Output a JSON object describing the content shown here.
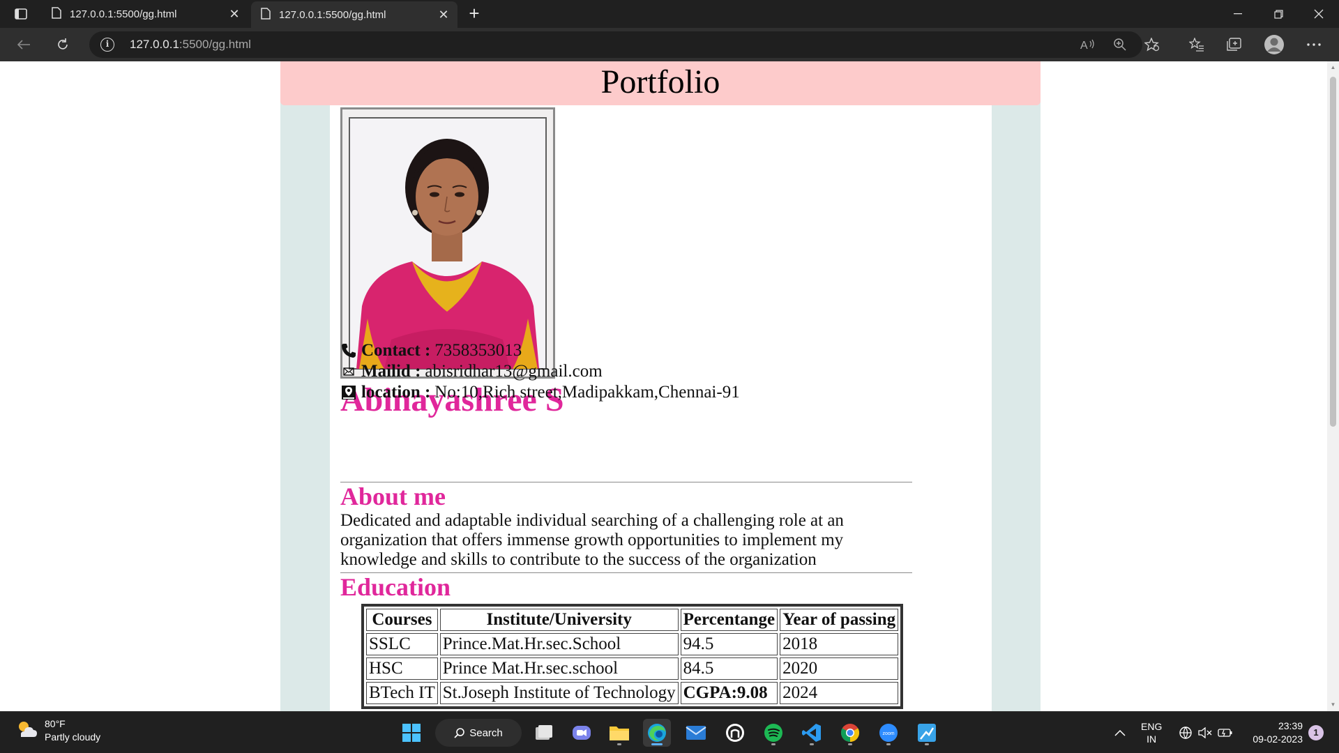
{
  "browser": {
    "tabs": [
      {
        "title": "127.0.0.1:5500/gg.html"
      },
      {
        "title": "127.0.0.1:5500/gg.html"
      }
    ],
    "address": {
      "host": "127.0.0.1",
      "path": ":5500/gg.html"
    }
  },
  "page": {
    "header_title": "Portfolio",
    "name": "Abinayashree S",
    "contact": {
      "label": "Contact :",
      "value": "7358353013"
    },
    "mail": {
      "label": "Mailid :",
      "value": "abisridhar13@gmail.com"
    },
    "location": {
      "label": "location :",
      "value": "No:10,Rich street,Madipakkam,Chennai-91"
    },
    "about_title": "About me",
    "about_text": "Dedicated and adaptable individual searching of a challenging role at an organization that offers immense growth opportunities to implement my knowledge and skills to contribute to the success of the organization",
    "education_title": "Education",
    "education": {
      "headers": [
        "Courses",
        "Institute/University",
        "Percentange",
        "Year of passing"
      ],
      "rows": [
        [
          "SSLC",
          "Prince.Mat.Hr.sec.School",
          "94.5",
          "2018"
        ],
        [
          "HSC",
          "Prince Mat.Hr.sec.school",
          "84.5",
          "2020"
        ],
        [
          "BTech IT",
          "St.Joseph Institute of Technology",
          "CGPA:9.08",
          "2024"
        ]
      ]
    }
  },
  "taskbar": {
    "weather": {
      "temp": "80°F",
      "condition": "Partly cloudy"
    },
    "search_label": "Search",
    "language": {
      "line1": "ENG",
      "line2": "IN"
    },
    "time": "23:39",
    "date": "09-02-2023",
    "notification_count": "1"
  },
  "colors": {
    "accent_pink": "#e0279b",
    "header_bg": "#fdcbcb",
    "outer_bg": "#dce9e8"
  }
}
